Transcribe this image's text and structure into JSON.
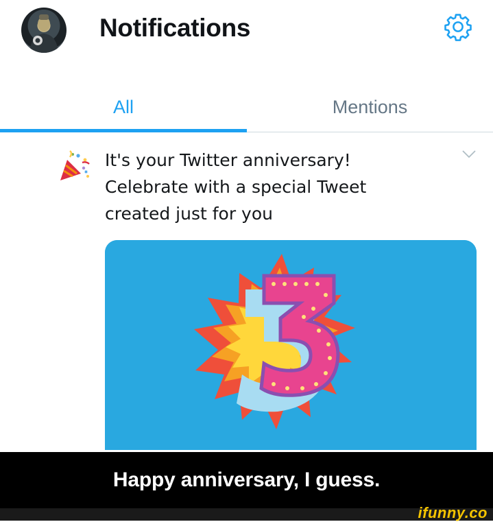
{
  "header": {
    "title": "Notifications",
    "avatar_icon": "avatar",
    "settings_icon": "gear-icon"
  },
  "tabs": [
    {
      "label": "All",
      "selected": true
    },
    {
      "label": "Mentions",
      "selected": false
    }
  ],
  "notification": {
    "icon": "party-popper-icon",
    "lines": [
      "It's your Twitter anniversary!",
      "Celebrate with a special Tweet",
      "created just for you"
    ],
    "menu_icon": "chevron-down-icon",
    "card_image": "anniversary-number-3-illustration"
  },
  "caption": "Happy anniversary, I guess.",
  "watermark": "ifunny.co",
  "colors": {
    "accent": "#1da1f2",
    "muted": "#657786",
    "card_bg": "#29a8e0",
    "watermark": "#f5c400"
  }
}
